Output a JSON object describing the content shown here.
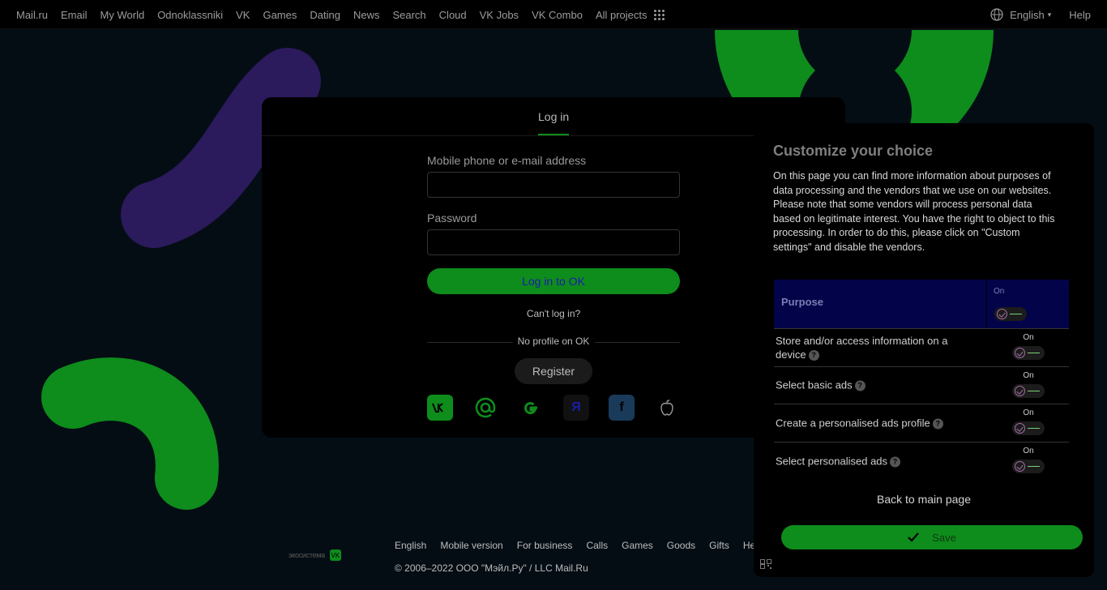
{
  "topnav": {
    "links": [
      "Mail.ru",
      "Email",
      "My World",
      "Odnoklassniki",
      "VK",
      "Games",
      "Dating",
      "News",
      "Search",
      "Cloud",
      "VK Jobs",
      "VK Combo",
      "All projects"
    ],
    "language": "English",
    "help": "Help"
  },
  "login": {
    "tab": "Log in",
    "login_label": "Mobile phone or e-mail address",
    "login_value": "",
    "password_label": "Password",
    "password_value": "",
    "submit": "Log in to OK",
    "cant_login": "Can't log in?",
    "no_profile": "No profile on OK",
    "register": "Register",
    "socials": [
      "vk",
      "mail-ru",
      "google",
      "yandex",
      "facebook",
      "apple"
    ]
  },
  "footer": {
    "logo_text": "экосистема",
    "links": [
      "English",
      "Mobile version",
      "For business",
      "Calls",
      "Games",
      "Goods",
      "Gifts",
      "Help"
    ],
    "copyright": "© 2006–2022 ООО \"Мэйл.Ру\" / LLC Mail.Ru"
  },
  "consent": {
    "title": "Customize your choice",
    "desc_1": "On this page you can find more information about purposes of data processing and the vendors that we use on our websites.",
    "desc_2": "Please note that some vendors will process personal data based on legitimate interest. You have the right to object to this processing. In order to do this, please click on \"Custom settings\" and disable the vendors.",
    "table_header": "Purpose",
    "header_toggle_label": "On",
    "purposes": [
      {
        "label": "Store and/or access information on a device",
        "state": "On"
      },
      {
        "label": "Select basic ads",
        "state": "On"
      },
      {
        "label": "Create a personalised ads profile",
        "state": "On"
      },
      {
        "label": "Select personalised ads",
        "state": "On"
      }
    ],
    "back": "Back to main page",
    "save": "Save"
  },
  "colors": {
    "background": "#040d14",
    "accent_green": "#0e8c1c",
    "purple_shape": "#2b1a5c",
    "table_header": "#03034a"
  }
}
